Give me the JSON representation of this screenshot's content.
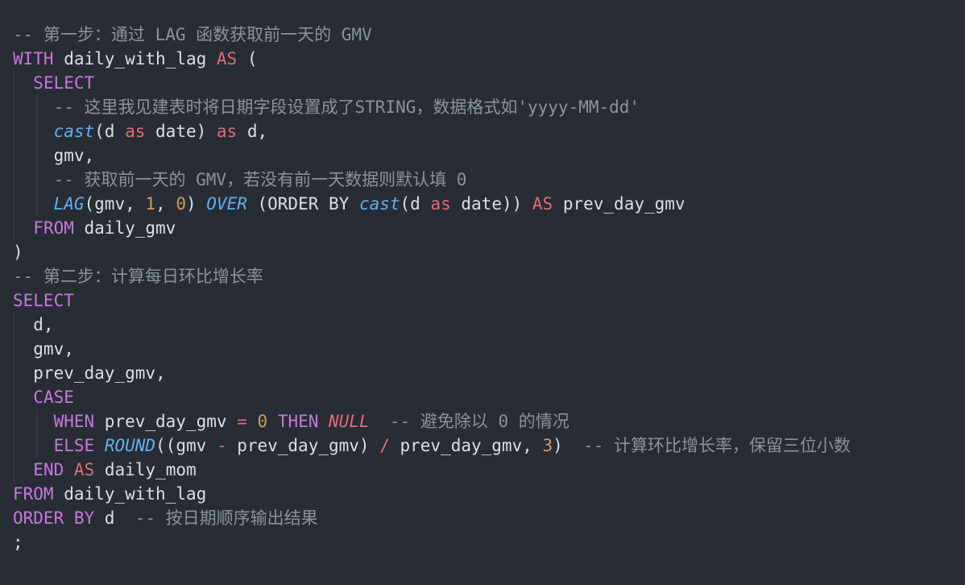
{
  "editor": {
    "theme": {
      "background": "#282c34",
      "keyword": "#c678dd",
      "keyword_as": "#e06c75",
      "function": "#61afef",
      "number": "#d19a66",
      "comment": "#8b929c",
      "text": "#dcdfe4"
    },
    "lines": [
      {
        "indent": 0,
        "tokens": [
          {
            "t": "cm",
            "v": "-- 第一步：通过 LAG 函数获取前一天的 GMV"
          }
        ]
      },
      {
        "indent": 0,
        "tokens": [
          {
            "t": "kw",
            "v": "WITH"
          },
          {
            "t": "pl",
            "v": " daily_with_lag "
          },
          {
            "t": "kw2",
            "v": "AS"
          },
          {
            "t": "pl",
            "v": " ("
          }
        ]
      },
      {
        "indent": 1,
        "tokens": [
          {
            "t": "pl",
            "v": "  "
          },
          {
            "t": "kw",
            "v": "SELECT"
          }
        ]
      },
      {
        "indent": 2,
        "tokens": [
          {
            "t": "pl",
            "v": "    "
          },
          {
            "t": "cm",
            "v": "-- 这里我见建表时将日期字段设置成了STRING，数据格式如'yyyy-MM-dd'"
          }
        ]
      },
      {
        "indent": 2,
        "tokens": [
          {
            "t": "pl",
            "v": "    "
          },
          {
            "t": "fn",
            "v": "cast"
          },
          {
            "t": "pl",
            "v": "(d "
          },
          {
            "t": "kw2",
            "v": "as"
          },
          {
            "t": "pl",
            "v": " date) "
          },
          {
            "t": "kw2",
            "v": "as"
          },
          {
            "t": "pl",
            "v": " d,"
          }
        ]
      },
      {
        "indent": 2,
        "tokens": [
          {
            "t": "pl",
            "v": "    gmv,"
          }
        ]
      },
      {
        "indent": 2,
        "tokens": [
          {
            "t": "pl",
            "v": "    "
          },
          {
            "t": "cm",
            "v": "-- 获取前一天的 GMV，若没有前一天数据则默认填 0"
          }
        ]
      },
      {
        "indent": 2,
        "tokens": [
          {
            "t": "pl",
            "v": "    "
          },
          {
            "t": "fn",
            "v": "LAG"
          },
          {
            "t": "pl",
            "v": "(gmv, "
          },
          {
            "t": "num",
            "v": "1"
          },
          {
            "t": "pl",
            "v": ", "
          },
          {
            "t": "num",
            "v": "0"
          },
          {
            "t": "pl",
            "v": ") "
          },
          {
            "t": "fn",
            "v": "OVER"
          },
          {
            "t": "pl",
            "v": " (ORDER BY "
          },
          {
            "t": "fn",
            "v": "cast"
          },
          {
            "t": "pl",
            "v": "(d "
          },
          {
            "t": "kw2",
            "v": "as"
          },
          {
            "t": "pl",
            "v": " date)) "
          },
          {
            "t": "kw2",
            "v": "AS"
          },
          {
            "t": "pl",
            "v": " prev_day_gmv"
          }
        ]
      },
      {
        "indent": 1,
        "tokens": [
          {
            "t": "pl",
            "v": "  "
          },
          {
            "t": "kw",
            "v": "FROM"
          },
          {
            "t": "pl",
            "v": " daily_gmv"
          }
        ]
      },
      {
        "indent": 0,
        "tokens": [
          {
            "t": "pl",
            "v": ")"
          }
        ]
      },
      {
        "indent": 0,
        "tokens": [
          {
            "t": "cm",
            "v": "-- 第二步：计算每日环比增长率"
          }
        ]
      },
      {
        "indent": 0,
        "tokens": [
          {
            "t": "kw",
            "v": "SELECT"
          }
        ]
      },
      {
        "indent": 1,
        "tokens": [
          {
            "t": "pl",
            "v": "  d,"
          }
        ]
      },
      {
        "indent": 1,
        "tokens": [
          {
            "t": "pl",
            "v": "  gmv,"
          }
        ]
      },
      {
        "indent": 1,
        "tokens": [
          {
            "t": "pl",
            "v": "  prev_day_gmv,"
          }
        ]
      },
      {
        "indent": 1,
        "tokens": [
          {
            "t": "pl",
            "v": "  "
          },
          {
            "t": "kw",
            "v": "CASE"
          }
        ]
      },
      {
        "indent": 2,
        "tokens": [
          {
            "t": "pl",
            "v": "    "
          },
          {
            "t": "kw",
            "v": "WHEN"
          },
          {
            "t": "pl",
            "v": " prev_day_gmv "
          },
          {
            "t": "kw2",
            "v": "="
          },
          {
            "t": "pl",
            "v": " "
          },
          {
            "t": "num",
            "v": "0"
          },
          {
            "t": "pl",
            "v": " "
          },
          {
            "t": "kw",
            "v": "THEN"
          },
          {
            "t": "pl",
            "v": " "
          },
          {
            "t": "kw2i",
            "v": "NULL"
          },
          {
            "t": "pl",
            "v": "  "
          },
          {
            "t": "cm",
            "v": "-- 避免除以 0 的情况"
          }
        ]
      },
      {
        "indent": 2,
        "tokens": [
          {
            "t": "pl",
            "v": "    "
          },
          {
            "t": "kw",
            "v": "ELSE"
          },
          {
            "t": "pl",
            "v": " "
          },
          {
            "t": "fn",
            "v": "ROUND"
          },
          {
            "t": "pl",
            "v": "((gmv "
          },
          {
            "t": "kw2",
            "v": "-"
          },
          {
            "t": "pl",
            "v": " prev_day_gmv) "
          },
          {
            "t": "kw2",
            "v": "/"
          },
          {
            "t": "pl",
            "v": " prev_day_gmv, "
          },
          {
            "t": "num",
            "v": "3"
          },
          {
            "t": "pl",
            "v": ")  "
          },
          {
            "t": "cm",
            "v": "-- 计算环比增长率，保留三位小数"
          }
        ]
      },
      {
        "indent": 1,
        "tokens": [
          {
            "t": "pl",
            "v": "  "
          },
          {
            "t": "kw",
            "v": "END"
          },
          {
            "t": "pl",
            "v": " "
          },
          {
            "t": "kw2",
            "v": "AS"
          },
          {
            "t": "pl",
            "v": " daily_mom"
          }
        ]
      },
      {
        "indent": 0,
        "tokens": [
          {
            "t": "kw",
            "v": "FROM"
          },
          {
            "t": "pl",
            "v": " daily_with_lag"
          }
        ]
      },
      {
        "indent": 0,
        "tokens": [
          {
            "t": "kw",
            "v": "ORDER BY"
          },
          {
            "t": "pl",
            "v": " d  "
          },
          {
            "t": "cm",
            "v": "-- 按日期顺序输出结果"
          }
        ]
      },
      {
        "indent": 0,
        "tokens": [
          {
            "t": "pl",
            "v": ";"
          }
        ]
      }
    ]
  }
}
